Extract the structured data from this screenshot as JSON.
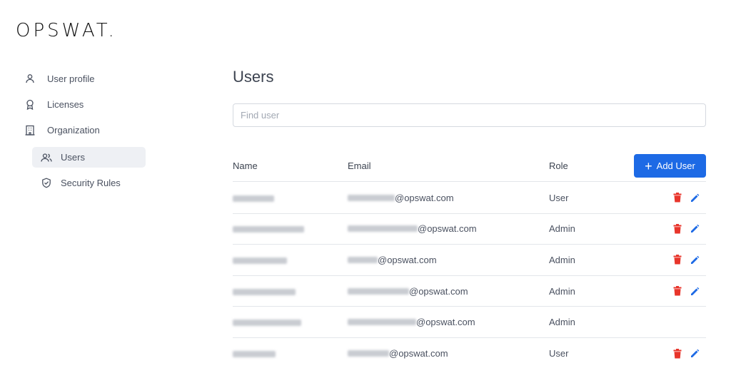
{
  "brand": {
    "logo_text": "OPSWAT."
  },
  "sidebar": {
    "items": [
      {
        "label": "User profile",
        "icon": "user-icon"
      },
      {
        "label": "Licenses",
        "icon": "award-icon"
      },
      {
        "label": "Organization",
        "icon": "building-icon"
      }
    ],
    "sub_items": [
      {
        "label": "Users",
        "icon": "users-icon",
        "active": true
      },
      {
        "label": "Security Rules",
        "icon": "shield-check-icon",
        "active": false
      }
    ]
  },
  "main": {
    "title": "Users",
    "search": {
      "placeholder": "Find user",
      "value": ""
    },
    "table": {
      "headers": {
        "name": "Name",
        "email": "Email",
        "role": "Role"
      },
      "add_button_label": "Add User",
      "rows": [
        {
          "email_domain": "@opswat.com",
          "role": "User",
          "actions": true
        },
        {
          "email_domain": "@opswat.com",
          "role": "Admin",
          "actions": true
        },
        {
          "email_domain": "@opswat.com",
          "role": "Admin",
          "actions": true
        },
        {
          "email_domain": "@opswat.com",
          "role": "Admin",
          "actions": true
        },
        {
          "email_domain": "@opswat.com",
          "role": "Admin",
          "actions": false
        },
        {
          "email_domain": "@opswat.com",
          "role": "User",
          "actions": true
        }
      ]
    }
  },
  "colors": {
    "accent": "#1d6ae5",
    "delete": "#e8352b",
    "edit": "#1d6ae5",
    "active_bg": "#eef0f4"
  }
}
